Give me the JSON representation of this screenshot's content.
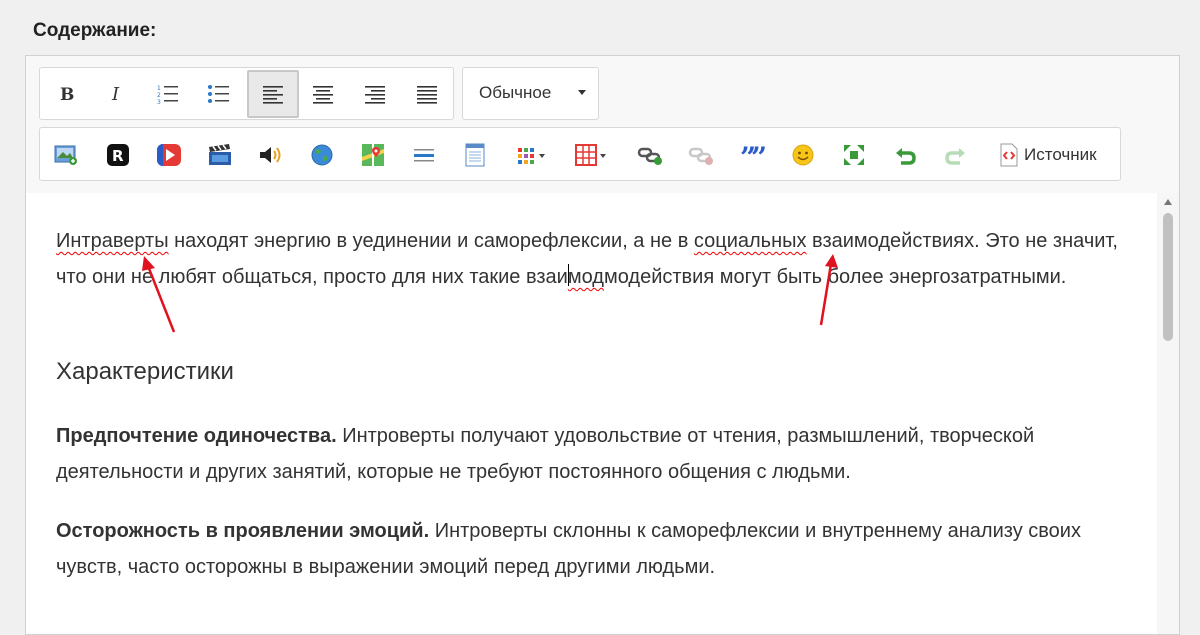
{
  "field": {
    "label": "Содержание:"
  },
  "toolbar": {
    "format_select": "Обычное",
    "source_label": "Источник",
    "buttons_row1": [
      "bold-icon",
      "italic-icon",
      "numbered-list-icon",
      "bulleted-list-icon",
      "align-left-icon",
      "align-center-icon",
      "align-right-icon",
      "align-justify-icon"
    ],
    "buttons_row2": [
      "image-icon",
      "r-logo-icon",
      "video-play-icon",
      "film-clapper-icon",
      "audio-speaker-icon",
      "globe-icon",
      "map-icon",
      "horizontal-line-icon",
      "table-doc-icon",
      "special-char-grid-icon",
      "table-grid-icon",
      "link-icon",
      "unlink-icon",
      "blockquote-icon",
      "smiley-icon",
      "maximize-icon",
      "undo-icon",
      "redo-icon",
      "source-code-icon"
    ],
    "accent_colors": {
      "active_bg": "#e9e9e9",
      "red_icons": "#e53935",
      "blue_icons": "#2a78c8",
      "green_icons": "#3a9a3a"
    }
  },
  "content": {
    "p1": {
      "word1": "Интраверты",
      "text1": " находят энергию в уединении и саморефлексии, а не в ",
      "word2": "социальных",
      "text2": " взаимодействиях. Это не значит, что они не любят общаться, просто для них такие взаи",
      "text3": "модействия могут быть более энергозатратными."
    },
    "heading": "Характеристики",
    "p2": {
      "bold": "Предпочтение одиночества.",
      "text": " Интроверты получают удовольствие от чтения, размышлений, творческой деятельности и других занятий, которые не требуют постоянного общения с людьми."
    },
    "p3": {
      "bold": "Осторожность в проявлении эмоций.",
      "text": " Интроверты склонны к саморефлексии и внутреннему анализу своих чувств, часто осторожны в выражении эмоций перед другими людьми."
    }
  },
  "annotations": {
    "arrow_color": "#e0121f"
  }
}
